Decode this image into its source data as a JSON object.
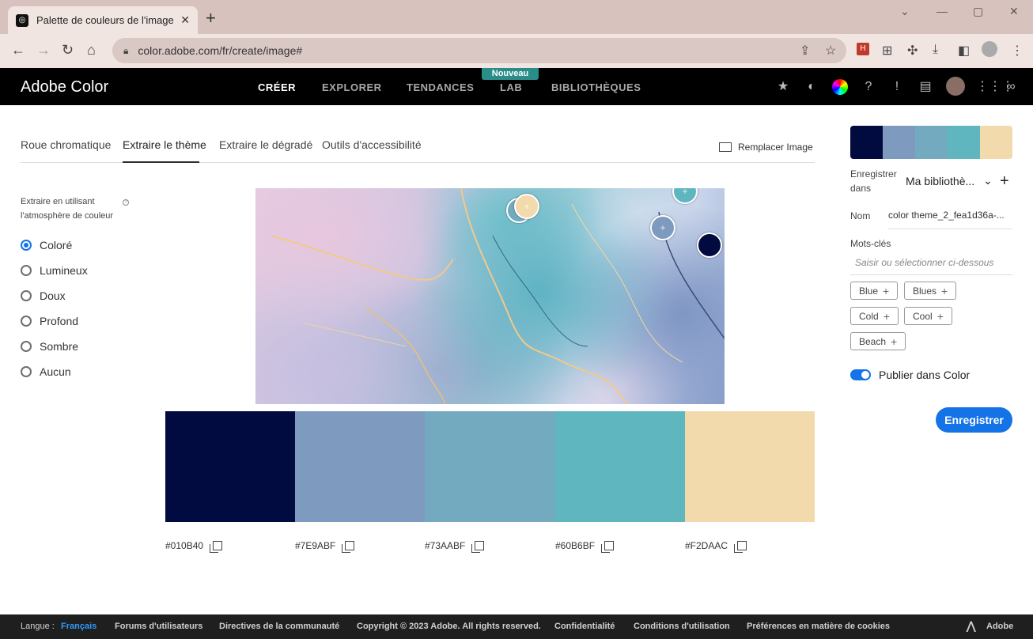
{
  "browser": {
    "tab_title": "Palette de couleurs de l'image | A",
    "url": "color.adobe.com/fr/create/image#"
  },
  "app": {
    "brand": "Adobe Color",
    "menu": [
      "CRÉER",
      "EXPLORER",
      "TENDANCES",
      "LAB",
      "BIBLIOTHÈQUES"
    ],
    "new_badge": "Nouveau"
  },
  "subtabs": [
    "Roue chromatique",
    "Extraire le thème",
    "Extraire le dégradé",
    "Outils d'accessibilité"
  ],
  "replace_image": "Remplacer Image",
  "mood": {
    "label": "Extraire en utilisant l'atmosphère de couleur",
    "options": [
      "Coloré",
      "Lumineux",
      "Doux",
      "Profond",
      "Sombre",
      "Aucun"
    ],
    "selected": "Coloré"
  },
  "palette": [
    {
      "hex": "#010B40",
      "label": "#010B40"
    },
    {
      "hex": "#7E9ABF",
      "label": "#7E9ABF"
    },
    {
      "hex": "#73AABF",
      "label": "#73AABF"
    },
    {
      "hex": "#60B6BF",
      "label": "#60B6BF"
    },
    {
      "hex": "#F2DAAC",
      "label": "#F2DAAC"
    }
  ],
  "panel": {
    "save_in_label": "Enregistrer dans",
    "save_in_value": "Ma bibliothè...",
    "name_label": "Nom",
    "name_value": "color theme_2_fea1d36a-...",
    "keywords_label": "Mots-clés",
    "keywords_placeholder": "Saisir ou sélectionner ci-dessous",
    "tags": [
      "Blue",
      "Blues",
      "Cold",
      "Cool",
      "Beach"
    ],
    "publish_label": "Publier dans Color",
    "publish_on": true,
    "save_button": "Enregistrer"
  },
  "footer": {
    "lang_label": "Langue :",
    "lang_value": "Français",
    "links": [
      "Forums d'utilisateurs",
      "Directives de la communauté",
      "Copyright © 2023 Adobe. All rights reserved.",
      "Confidentialité",
      "Conditions d'utilisation",
      "Préférences en matière de cookies"
    ],
    "adobe": "Adobe"
  }
}
